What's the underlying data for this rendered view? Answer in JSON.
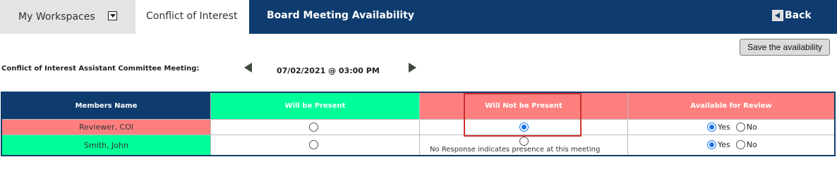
{
  "nav": {
    "workspaces_label": "My Workspaces",
    "coi_tab_label": "Conflict of Interest",
    "page_title": "Board Meeting Availability",
    "back_label": "Back"
  },
  "toolbar": {
    "save_label": "Save the availability"
  },
  "meeting": {
    "label": "Conflict of Interest Assistant Committee Meeting:",
    "datetime": "07/02/2021 @ 03:00 PM"
  },
  "table": {
    "headers": [
      "Members Name",
      "Will be Present",
      "Will Not be Present",
      "Available for Review"
    ],
    "rows": [
      {
        "name": "Reviewer, COI",
        "will_be_present": false,
        "will_not_be_present": true,
        "available_for_review": "Yes"
      },
      {
        "name": "Smith, John",
        "will_be_present": false,
        "will_not_be_present": false,
        "available_for_review": "Yes"
      }
    ],
    "yes_label": "Yes",
    "no_label": "No",
    "no_response_note": "No Response indicates presence at this meeting"
  },
  "colors": {
    "navy": "#0f3c6e",
    "green": "#00ff99",
    "red": "#ff7f7f",
    "highlight": "#d03030",
    "radio_selected": "#1a73e8"
  }
}
